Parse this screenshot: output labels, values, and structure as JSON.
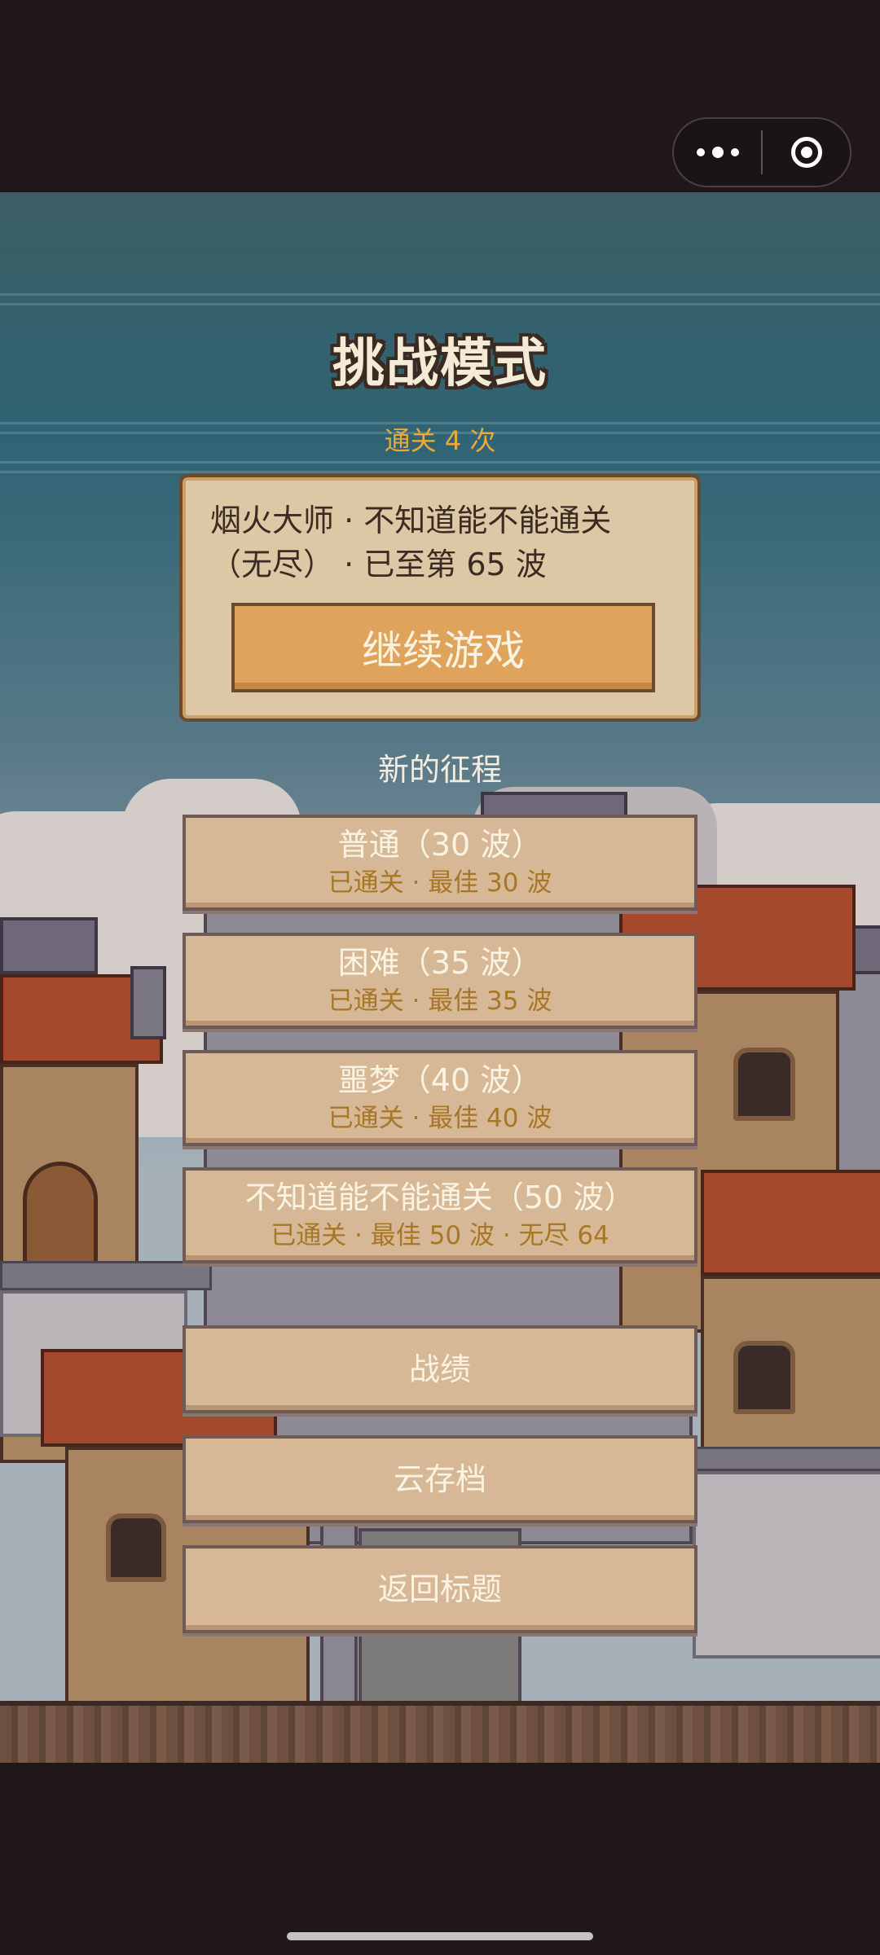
{
  "title": "挑战模式",
  "clears_text": "通关 4 次",
  "save_panel": {
    "line1": "烟火大师 · 不知道能不能通关",
    "line2": "（无尽） · 已至第 65 波",
    "continue_label": "继续游戏"
  },
  "new_journey_label": "新的征程",
  "difficulties": [
    {
      "label": "普通（30 波）",
      "status": "已通关 · 最佳 30 波"
    },
    {
      "label": "困难（35 波）",
      "status": "已通关 · 最佳 35 波"
    },
    {
      "label": "噩梦（40 波）",
      "status": "已通关 · 最佳 40 波"
    },
    {
      "label": "不知道能不能通关（50 波）",
      "status": "已通关 · 最佳 50 波 · 无尽 64"
    }
  ],
  "menu": {
    "records_label": "战绩",
    "cloud_save_label": "云存档",
    "return_title_label": "返回标题"
  },
  "colors": {
    "accent_gold": "#e8a93d",
    "button_orange": "#e0a35b",
    "panel_beige": "#ddc8a6",
    "option_tan": "#d7b896"
  }
}
